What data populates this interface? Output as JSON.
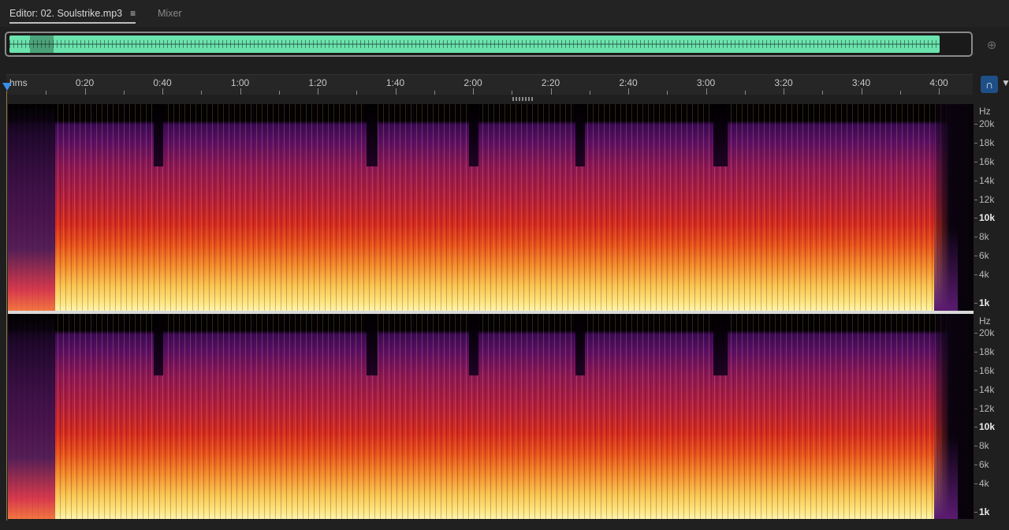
{
  "tabs": {
    "editor_label": "Editor: 02. Soulstrike.mp3",
    "editor_menu_icon": "≡",
    "mixer_label": "Mixer"
  },
  "overview": {
    "zoom_icon": "zoom-in-icon"
  },
  "ruler": {
    "unit": "hms",
    "labels": [
      "0:20",
      "0:40",
      "1:00",
      "1:20",
      "1:40",
      "2:00",
      "2:20",
      "2:40",
      "3:00",
      "3:20",
      "3:40",
      "4:00"
    ],
    "snap_icon": "headphones-icon",
    "marker_icon": "marker-icon"
  },
  "frequency_axis": {
    "unit": "Hz",
    "labels": [
      "20k",
      "18k",
      "16k",
      "14k",
      "12k",
      "10k",
      "8k",
      "6k",
      "4k",
      "1k"
    ],
    "bold_labels": [
      "10k",
      "1k"
    ]
  },
  "colors": {
    "accent": "#3a8ee8",
    "waveform": "#6be3ad",
    "spectrogram_low": "#fde680",
    "spectrogram_mid": "#d42a1e",
    "spectrogram_high": "#5a0f63"
  }
}
